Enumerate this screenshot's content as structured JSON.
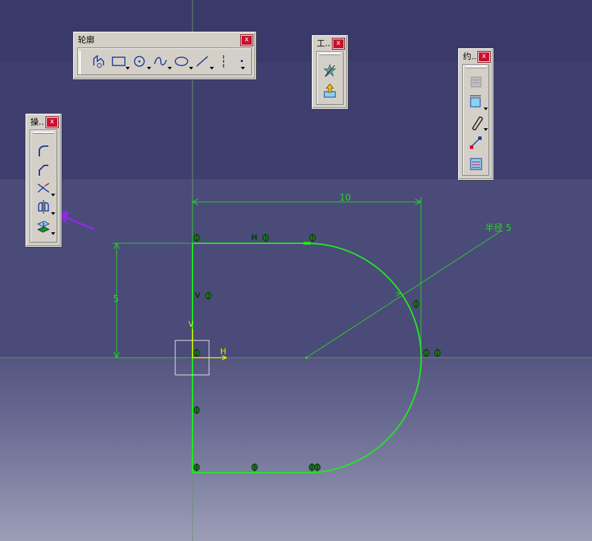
{
  "toolbars": {
    "profile": {
      "title": "轮廓",
      "close": "x"
    },
    "tools": {
      "title": "工..",
      "close": "x"
    },
    "constraints": {
      "title": "约..",
      "close": "x"
    },
    "operations": {
      "title": "操..",
      "close": "x"
    }
  },
  "sketch": {
    "dim_width": "10",
    "dim_height": "5",
    "dim_radius": "半径 5",
    "axis_h": "H",
    "axis_v": "V",
    "h_constraint": "H",
    "v_constraint": "V"
  },
  "colors": {
    "sketch_green": "#22e822",
    "dim_green": "#2bd22b",
    "axis_yellow": "#e8e800",
    "arrow_purple": "#8a2be2"
  }
}
